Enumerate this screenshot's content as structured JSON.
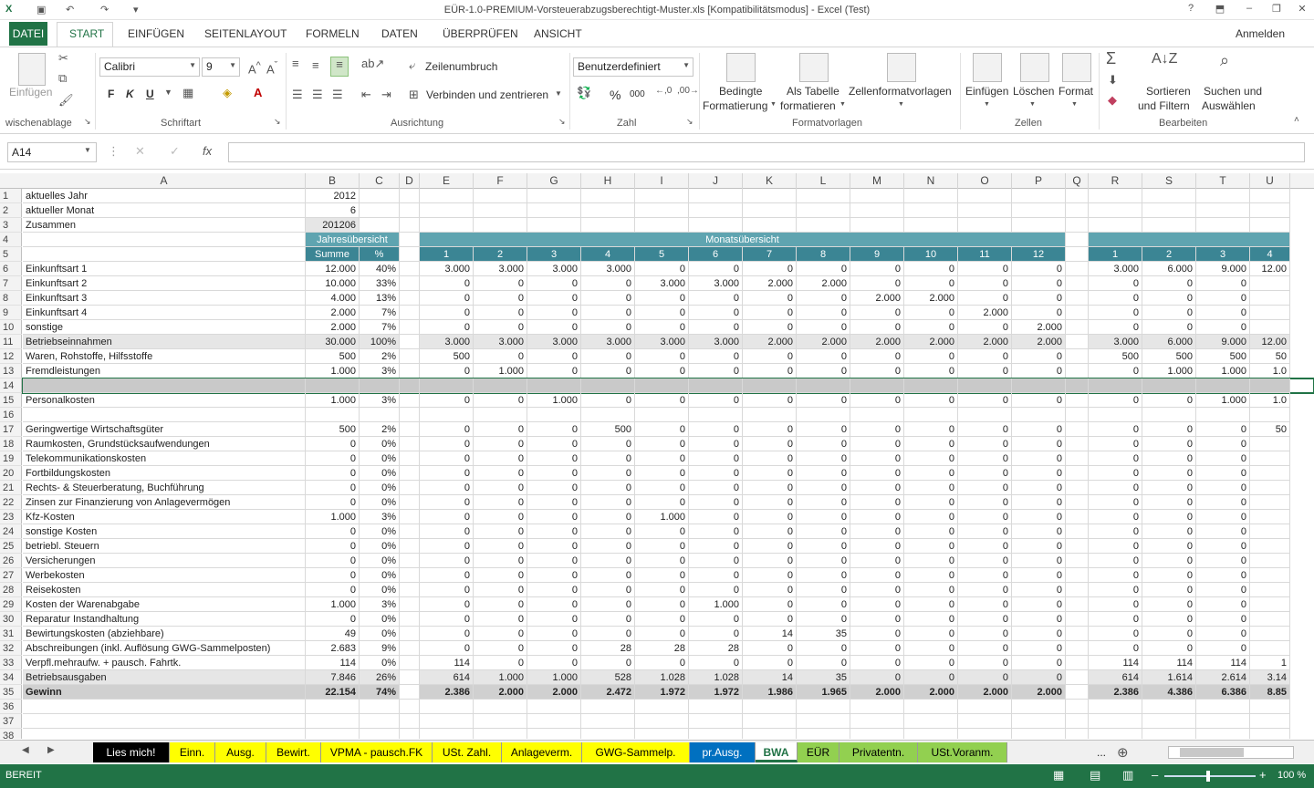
{
  "window": {
    "title": "EÜR-1.0-PREMIUM-Vorsteuerabzugsberechtigt-Muster.xls  [Kompatibilitätsmodus] - Excel (Test)"
  },
  "tabs": [
    "DATEI",
    "START",
    "EINFÜGEN",
    "SEITENLAYOUT",
    "FORMELN",
    "DATEN",
    "ÜBERPRÜFEN",
    "ANSICHT"
  ],
  "account": "Anmelden",
  "ribbon": {
    "clipboard": {
      "paste": "Einfügen",
      "label": "wischenablage"
    },
    "font": {
      "name": "Calibri",
      "size": "9",
      "bold": "F",
      "italic": "K",
      "underline": "U",
      "label": "Schriftart"
    },
    "alignment": {
      "wrap": "Zeilenumbruch",
      "merge": "Verbinden und zentrieren",
      "label": "Ausrichtung"
    },
    "number": {
      "format": "Benutzerdefiniert",
      "percent": "%",
      "thousands": "000",
      "label": "Zahl"
    },
    "styles": {
      "conditional1": "Bedingte",
      "conditional2": "Formatierung",
      "table1": "Als Tabelle",
      "table2": "formatieren",
      "cellstyles": "Zellenformatvorlagen",
      "label": "Formatvorlagen"
    },
    "cells": {
      "insert": "Einfügen",
      "delete": "Löschen",
      "format": "Format",
      "label": "Zellen"
    },
    "editing": {
      "sort1": "Sortieren",
      "sort2": "und Filtern",
      "find1": "Suchen und",
      "find2": "Auswählen",
      "label": "Bearbeiten"
    }
  },
  "formula": {
    "namebox": "A14",
    "fx": "fx",
    "cancel": "✕",
    "confirm": "✓"
  },
  "columns": [
    "A",
    "B",
    "C",
    "D",
    "E",
    "F",
    "G",
    "H",
    "I",
    "J",
    "K",
    "L",
    "M",
    "N",
    "O",
    "P",
    "Q",
    "R",
    "S",
    "T",
    "U"
  ],
  "header_rows": {
    "jahres": "Jahresübersicht",
    "monats": "Monatsübersicht",
    "summe": "Summe",
    "pct": "%",
    "months": [
      "1",
      "2",
      "3",
      "4",
      "5",
      "6",
      "7",
      "8",
      "9",
      "10",
      "11",
      "12"
    ],
    "cum": [
      "1",
      "2",
      "3",
      "4"
    ]
  },
  "top": [
    {
      "n": "1",
      "label": "aktuelles Jahr",
      "val": "2012"
    },
    {
      "n": "2",
      "label": "aktueller Monat",
      "val": "6"
    },
    {
      "n": "3",
      "label": "Zusammen",
      "val": "201206"
    }
  ],
  "rows": [
    {
      "n": "6",
      "label": "Einkunftsart 1",
      "sum": "12.000",
      "pct": "40%",
      "m": [
        "3.000",
        "3.000",
        "3.000",
        "3.000",
        "0",
        "0",
        "0",
        "0",
        "0",
        "0",
        "0",
        "0"
      ],
      "c": [
        "3.000",
        "6.000",
        "9.000",
        "12.00"
      ]
    },
    {
      "n": "7",
      "label": "Einkunftsart 2",
      "sum": "10.000",
      "pct": "33%",
      "m": [
        "0",
        "0",
        "0",
        "0",
        "3.000",
        "3.000",
        "2.000",
        "2.000",
        "0",
        "0",
        "0",
        "0"
      ],
      "c": [
        "0",
        "0",
        "0",
        ""
      ]
    },
    {
      "n": "8",
      "label": "Einkunftsart 3",
      "sum": "4.000",
      "pct": "13%",
      "m": [
        "0",
        "0",
        "0",
        "0",
        "0",
        "0",
        "0",
        "0",
        "2.000",
        "2.000",
        "0",
        "0"
      ],
      "c": [
        "0",
        "0",
        "0",
        ""
      ]
    },
    {
      "n": "9",
      "label": "Einkunftsart 4",
      "sum": "2.000",
      "pct": "7%",
      "m": [
        "0",
        "0",
        "0",
        "0",
        "0",
        "0",
        "0",
        "0",
        "0",
        "0",
        "2.000",
        "0"
      ],
      "c": [
        "0",
        "0",
        "0",
        ""
      ]
    },
    {
      "n": "10",
      "label": "sonstige",
      "sum": "2.000",
      "pct": "7%",
      "m": [
        "0",
        "0",
        "0",
        "0",
        "0",
        "0",
        "0",
        "0",
        "0",
        "0",
        "0",
        "2.000"
      ],
      "c": [
        "0",
        "0",
        "0",
        ""
      ]
    },
    {
      "n": "11",
      "label": "Betriebseinnahmen",
      "sum": "30.000",
      "pct": "100%",
      "m": [
        "3.000",
        "3.000",
        "3.000",
        "3.000",
        "3.000",
        "3.000",
        "2.000",
        "2.000",
        "2.000",
        "2.000",
        "2.000",
        "2.000"
      ],
      "c": [
        "3.000",
        "6.000",
        "9.000",
        "12.00"
      ],
      "shade": true
    },
    {
      "n": "12",
      "label": "Waren, Rohstoffe, Hilfsstoffe",
      "sum": "500",
      "pct": "2%",
      "m": [
        "500",
        "0",
        "0",
        "0",
        "0",
        "0",
        "0",
        "0",
        "0",
        "0",
        "0",
        "0"
      ],
      "c": [
        "500",
        "500",
        "500",
        "50"
      ]
    },
    {
      "n": "13",
      "label": "Fremdleistungen",
      "sum": "1.000",
      "pct": "3%",
      "m": [
        "0",
        "1.000",
        "0",
        "0",
        "0",
        "0",
        "0",
        "0",
        "0",
        "0",
        "0",
        "0"
      ],
      "c": [
        "0",
        "1.000",
        "1.000",
        "1.0"
      ]
    },
    {
      "n": "14",
      "label": "",
      "sum": "",
      "pct": "",
      "m": [
        "",
        "",
        "",
        "",
        "",
        "",
        "",
        "",
        "",
        "",
        "",
        ""
      ],
      "c": [
        "",
        "",
        "",
        ""
      ],
      "sel": true
    },
    {
      "n": "15",
      "label": "Personalkosten",
      "sum": "1.000",
      "pct": "3%",
      "m": [
        "0",
        "0",
        "1.000",
        "0",
        "0",
        "0",
        "0",
        "0",
        "0",
        "0",
        "0",
        "0"
      ],
      "c": [
        "0",
        "0",
        "1.000",
        "1.0"
      ]
    },
    {
      "n": "16",
      "label": "",
      "sum": "",
      "pct": "",
      "m": [
        "",
        "",
        "",
        "",
        "",
        "",
        "",
        "",
        "",
        "",
        "",
        ""
      ],
      "c": [
        "",
        "",
        "",
        ""
      ]
    },
    {
      "n": "17",
      "label": "Geringwertige Wirtschaftsgüter",
      "sum": "500",
      "pct": "2%",
      "m": [
        "0",
        "0",
        "0",
        "500",
        "0",
        "0",
        "0",
        "0",
        "0",
        "0",
        "0",
        "0"
      ],
      "c": [
        "0",
        "0",
        "0",
        "50"
      ]
    },
    {
      "n": "18",
      "label": "Raumkosten, Grundstücksaufwendungen",
      "sum": "0",
      "pct": "0%",
      "m": [
        "0",
        "0",
        "0",
        "0",
        "0",
        "0",
        "0",
        "0",
        "0",
        "0",
        "0",
        "0"
      ],
      "c": [
        "0",
        "0",
        "0",
        ""
      ]
    },
    {
      "n": "19",
      "label": "Telekommunikationskosten",
      "sum": "0",
      "pct": "0%",
      "m": [
        "0",
        "0",
        "0",
        "0",
        "0",
        "0",
        "0",
        "0",
        "0",
        "0",
        "0",
        "0"
      ],
      "c": [
        "0",
        "0",
        "0",
        ""
      ]
    },
    {
      "n": "20",
      "label": "Fortbildungskosten",
      "sum": "0",
      "pct": "0%",
      "m": [
        "0",
        "0",
        "0",
        "0",
        "0",
        "0",
        "0",
        "0",
        "0",
        "0",
        "0",
        "0"
      ],
      "c": [
        "0",
        "0",
        "0",
        ""
      ]
    },
    {
      "n": "21",
      "label": "Rechts- & Steuerberatung, Buchführung",
      "sum": "0",
      "pct": "0%",
      "m": [
        "0",
        "0",
        "0",
        "0",
        "0",
        "0",
        "0",
        "0",
        "0",
        "0",
        "0",
        "0"
      ],
      "c": [
        "0",
        "0",
        "0",
        ""
      ]
    },
    {
      "n": "22",
      "label": "Zinsen zur Finanzierung von Anlagevermögen",
      "sum": "0",
      "pct": "0%",
      "m": [
        "0",
        "0",
        "0",
        "0",
        "0",
        "0",
        "0",
        "0",
        "0",
        "0",
        "0",
        "0"
      ],
      "c": [
        "0",
        "0",
        "0",
        ""
      ]
    },
    {
      "n": "23",
      "label": "Kfz-Kosten",
      "sum": "1.000",
      "pct": "3%",
      "m": [
        "0",
        "0",
        "0",
        "0",
        "1.000",
        "0",
        "0",
        "0",
        "0",
        "0",
        "0",
        "0"
      ],
      "c": [
        "0",
        "0",
        "0",
        ""
      ]
    },
    {
      "n": "24",
      "label": "sonstige Kosten",
      "sum": "0",
      "pct": "0%",
      "m": [
        "0",
        "0",
        "0",
        "0",
        "0",
        "0",
        "0",
        "0",
        "0",
        "0",
        "0",
        "0"
      ],
      "c": [
        "0",
        "0",
        "0",
        ""
      ]
    },
    {
      "n": "25",
      "label": "betriebl. Steuern",
      "sum": "0",
      "pct": "0%",
      "m": [
        "0",
        "0",
        "0",
        "0",
        "0",
        "0",
        "0",
        "0",
        "0",
        "0",
        "0",
        "0"
      ],
      "c": [
        "0",
        "0",
        "0",
        ""
      ]
    },
    {
      "n": "26",
      "label": "Versicherungen",
      "sum": "0",
      "pct": "0%",
      "m": [
        "0",
        "0",
        "0",
        "0",
        "0",
        "0",
        "0",
        "0",
        "0",
        "0",
        "0",
        "0"
      ],
      "c": [
        "0",
        "0",
        "0",
        ""
      ]
    },
    {
      "n": "27",
      "label": "Werbekosten",
      "sum": "0",
      "pct": "0%",
      "m": [
        "0",
        "0",
        "0",
        "0",
        "0",
        "0",
        "0",
        "0",
        "0",
        "0",
        "0",
        "0"
      ],
      "c": [
        "0",
        "0",
        "0",
        ""
      ]
    },
    {
      "n": "28",
      "label": "Reisekosten",
      "sum": "0",
      "pct": "0%",
      "m": [
        "0",
        "0",
        "0",
        "0",
        "0",
        "0",
        "0",
        "0",
        "0",
        "0",
        "0",
        "0"
      ],
      "c": [
        "0",
        "0",
        "0",
        ""
      ]
    },
    {
      "n": "29",
      "label": "Kosten der Warenabgabe",
      "sum": "1.000",
      "pct": "3%",
      "m": [
        "0",
        "0",
        "0",
        "0",
        "0",
        "1.000",
        "0",
        "0",
        "0",
        "0",
        "0",
        "0"
      ],
      "c": [
        "0",
        "0",
        "0",
        ""
      ]
    },
    {
      "n": "30",
      "label": "Reparatur Instandhaltung",
      "sum": "0",
      "pct": "0%",
      "m": [
        "0",
        "0",
        "0",
        "0",
        "0",
        "0",
        "0",
        "0",
        "0",
        "0",
        "0",
        "0"
      ],
      "c": [
        "0",
        "0",
        "0",
        ""
      ]
    },
    {
      "n": "31",
      "label": "Bewirtungskosten (abziehbare)",
      "sum": "49",
      "pct": "0%",
      "m": [
        "0",
        "0",
        "0",
        "0",
        "0",
        "0",
        "14",
        "35",
        "0",
        "0",
        "0",
        "0"
      ],
      "c": [
        "0",
        "0",
        "0",
        ""
      ]
    },
    {
      "n": "32",
      "label": "Abschreibungen (inkl. Auflösung GWG-Sammelposten)",
      "sum": "2.683",
      "pct": "9%",
      "m": [
        "0",
        "0",
        "0",
        "28",
        "28",
        "28",
        "0",
        "0",
        "0",
        "0",
        "0",
        "0"
      ],
      "c": [
        "0",
        "0",
        "0",
        ""
      ]
    },
    {
      "n": "33",
      "label": "Verpfl.mehraufw. + pausch. Fahrtk.",
      "sum": "114",
      "pct": "0%",
      "m": [
        "114",
        "0",
        "0",
        "0",
        "0",
        "0",
        "0",
        "0",
        "0",
        "0",
        "0",
        "0"
      ],
      "c": [
        "114",
        "114",
        "114",
        "1"
      ]
    },
    {
      "n": "34",
      "label": "Betriebsausgaben",
      "sum": "7.846",
      "pct": "26%",
      "m": [
        "614",
        "1.000",
        "1.000",
        "528",
        "1.028",
        "1.028",
        "14",
        "35",
        "0",
        "0",
        "0",
        "0"
      ],
      "c": [
        "614",
        "1.614",
        "2.614",
        "3.14"
      ],
      "shade": true
    },
    {
      "n": "35",
      "label": "Gewinn",
      "sum": "22.154",
      "pct": "74%",
      "m": [
        "2.386",
        "2.000",
        "2.000",
        "2.472",
        "1.972",
        "1.972",
        "1.986",
        "1.965",
        "2.000",
        "2.000",
        "2.000",
        "2.000"
      ],
      "c": [
        "2.386",
        "4.386",
        "6.386",
        "8.85"
      ],
      "gray": true,
      "bold": true
    }
  ],
  "empty_rows": [
    "36",
    "37",
    "38"
  ],
  "sheets": [
    {
      "name": "Lies mich!",
      "bg": "#000000",
      "fg": "#ffffff"
    },
    {
      "name": "Einn.",
      "bg": "#ffff00",
      "fg": "#000000"
    },
    {
      "name": "Ausg.",
      "bg": "#ffff00",
      "fg": "#000000"
    },
    {
      "name": "Bewirt.",
      "bg": "#ffff00",
      "fg": "#000000"
    },
    {
      "name": "VPMA - pausch.FK",
      "bg": "#ffff00",
      "fg": "#000000"
    },
    {
      "name": "USt. Zahl.",
      "bg": "#ffff00",
      "fg": "#000000"
    },
    {
      "name": "Anlageverm.",
      "bg": "#ffff00",
      "fg": "#000000"
    },
    {
      "name": "GWG-Sammelp.",
      "bg": "#ffff00",
      "fg": "#000000"
    },
    {
      "name": "pr.Ausg.",
      "bg": "#0070c0",
      "fg": "#ffffff"
    },
    {
      "name": "BWA",
      "bg": "#ffffff",
      "fg": "#217346"
    },
    {
      "name": "EÜR",
      "bg": "#92d050",
      "fg": "#000000"
    },
    {
      "name": "Privatentn.",
      "bg": "#92d050",
      "fg": "#000000"
    },
    {
      "name": "USt.Voranm.",
      "bg": "#92d050",
      "fg": "#000000"
    }
  ],
  "sheet_more": "...",
  "status": {
    "mode": "BEREIT",
    "zoom": "100 %"
  },
  "colors": {
    "accent": "#217346",
    "header_teal": "#5fa4b0"
  }
}
